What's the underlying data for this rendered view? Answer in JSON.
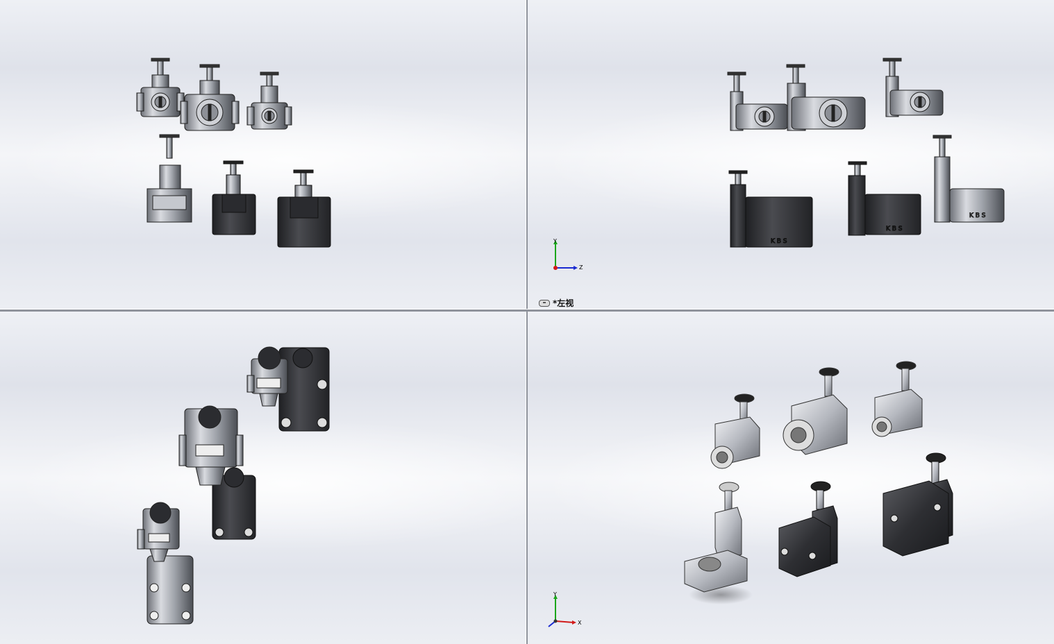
{
  "viewports": {
    "top_left": {},
    "top_right": {
      "label": "*左视",
      "triad": {
        "y_label": "Y",
        "z_label": "Z"
      }
    },
    "bottom_left": {},
    "bottom_right": {
      "triad": {
        "y_label": "Y",
        "x_label": "X"
      }
    }
  },
  "colors": {
    "axis_x": "#d11a1a",
    "axis_y": "#1aa61a",
    "axis_z": "#1a2ad1",
    "part_dark": "#3a3b3f",
    "part_light": "#b9bcc3"
  }
}
